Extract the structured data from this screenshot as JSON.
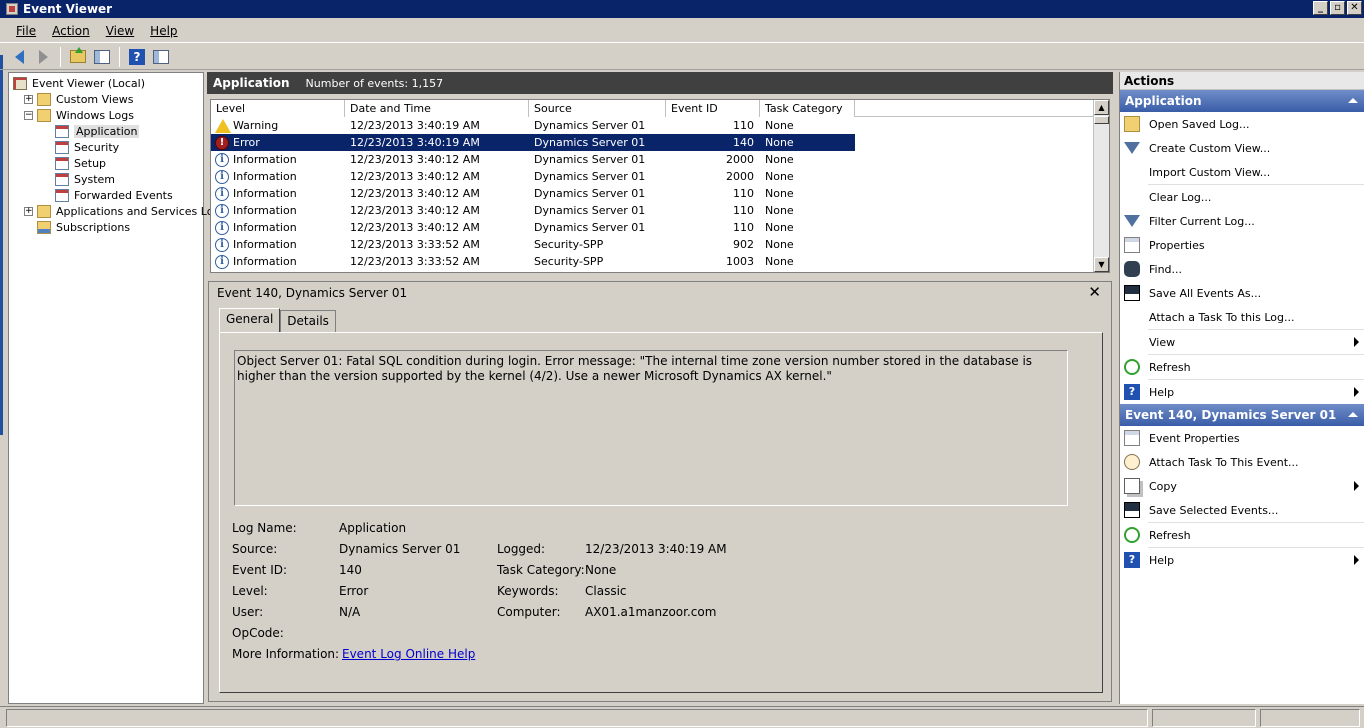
{
  "window": {
    "title": "Event Viewer"
  },
  "menu": [
    "File",
    "Action",
    "View",
    "Help"
  ],
  "tree": {
    "items": [
      {
        "label": "Event Viewer (Local)",
        "indent": 0
      },
      {
        "label": "Custom Views",
        "indent": 1,
        "expander": "+"
      },
      {
        "label": "Windows Logs",
        "indent": 1,
        "expander": "−"
      },
      {
        "label": "Application",
        "indent": 2,
        "selected": true
      },
      {
        "label": "Security",
        "indent": 2
      },
      {
        "label": "Setup",
        "indent": 2
      },
      {
        "label": "System",
        "indent": 2
      },
      {
        "label": "Forwarded Events",
        "indent": 2
      },
      {
        "label": "Applications and Services Logs",
        "indent": 1,
        "expander": "+"
      },
      {
        "label": "Subscriptions",
        "indent": 1
      }
    ]
  },
  "log": {
    "title": "Application",
    "count_text": "Number of events: 1,157",
    "columns": [
      "Level",
      "Date and Time",
      "Source",
      "Event ID",
      "Task Category"
    ],
    "rows": [
      {
        "level": "Warning",
        "icon": "warning-icon",
        "date": "12/23/2013 3:40:19 AM",
        "source": "Dynamics Server 01",
        "id": "110",
        "category": "None"
      },
      {
        "level": "Error",
        "icon": "error-icon",
        "date": "12/23/2013 3:40:19 AM",
        "source": "Dynamics Server 01",
        "id": "140",
        "category": "None",
        "selected": true
      },
      {
        "level": "Information",
        "icon": "info-icon",
        "date": "12/23/2013 3:40:12 AM",
        "source": "Dynamics Server 01",
        "id": "2000",
        "category": "None"
      },
      {
        "level": "Information",
        "icon": "info-icon",
        "date": "12/23/2013 3:40:12 AM",
        "source": "Dynamics Server 01",
        "id": "2000",
        "category": "None"
      },
      {
        "level": "Information",
        "icon": "info-icon",
        "date": "12/23/2013 3:40:12 AM",
        "source": "Dynamics Server 01",
        "id": "110",
        "category": "None"
      },
      {
        "level": "Information",
        "icon": "info-icon",
        "date": "12/23/2013 3:40:12 AM",
        "source": "Dynamics Server 01",
        "id": "110",
        "category": "None"
      },
      {
        "level": "Information",
        "icon": "info-icon",
        "date": "12/23/2013 3:40:12 AM",
        "source": "Dynamics Server 01",
        "id": "110",
        "category": "None"
      },
      {
        "level": "Information",
        "icon": "info-icon",
        "date": "12/23/2013 3:33:52 AM",
        "source": "Security-SPP",
        "id": "902",
        "category": "None"
      },
      {
        "level": "Information",
        "icon": "info-icon",
        "date": "12/23/2013 3:33:52 AM",
        "source": "Security-SPP",
        "id": "1003",
        "category": "None"
      }
    ]
  },
  "detail": {
    "title": "Event 140, Dynamics Server 01",
    "tabs": [
      "General",
      "Details"
    ],
    "message": "Object Server 01:  Fatal SQL condition during login. Error message: \"The internal time zone version number stored in the database is higher than the version supported by the kernel (4/2). Use a newer Microsoft Dynamics AX kernel.\"",
    "fields": {
      "log_name_label": "Log Name:",
      "log_name": "Application",
      "source_label": "Source:",
      "source": "Dynamics Server 01",
      "logged_label": "Logged:",
      "logged": "12/23/2013 3:40:19 AM",
      "event_id_label": "Event ID:",
      "event_id": "140",
      "task_category_label": "Task Category:",
      "task_category": "None",
      "level_label": "Level:",
      "level": "Error",
      "keywords_label": "Keywords:",
      "keywords": "Classic",
      "user_label": "User:",
      "user": "N/A",
      "computer_label": "Computer:",
      "computer": "AX01.a1manzoor.com",
      "opcode_label": "OpCode:",
      "more_info_label": "More Information:",
      "more_info_link": "Event Log Online Help"
    }
  },
  "actions": {
    "title": "Actions",
    "sections": [
      {
        "header": "Application",
        "items": [
          {
            "label": "Open Saved Log...",
            "icon": "open-log-icon"
          },
          {
            "label": "Create Custom View...",
            "icon": "filter-icon"
          },
          {
            "label": "Import Custom View...",
            "icon": ""
          },
          {
            "label": "Clear Log...",
            "icon": "",
            "sep_before": true
          },
          {
            "label": "Filter Current Log...",
            "icon": "filter-icon"
          },
          {
            "label": "Properties",
            "icon": "properties-icon"
          },
          {
            "label": "Find...",
            "icon": "find-icon"
          },
          {
            "label": "Save All Events As...",
            "icon": "save-icon"
          },
          {
            "label": "Attach a Task To this Log...",
            "icon": ""
          },
          {
            "label": "View",
            "icon": "",
            "submenu": true,
            "sep_before": true
          },
          {
            "label": "Refresh",
            "icon": "refresh-icon",
            "sep_before": true
          },
          {
            "label": "Help",
            "icon": "help-icon",
            "submenu": true,
            "sep_before": true
          }
        ]
      },
      {
        "header": "Event 140, Dynamics Server 01",
        "items": [
          {
            "label": "Event Properties",
            "icon": "properties-icon"
          },
          {
            "label": "Attach Task To This Event...",
            "icon": "task-icon"
          },
          {
            "label": "Copy",
            "icon": "copy-icon",
            "submenu": true
          },
          {
            "label": "Save Selected Events...",
            "icon": "save-icon"
          },
          {
            "label": "Refresh",
            "icon": "refresh-icon",
            "sep_before": true
          },
          {
            "label": "Help",
            "icon": "help-icon",
            "submenu": true,
            "sep_before": true
          }
        ]
      }
    ]
  },
  "colors": {
    "title_bar": "#0a246a",
    "selection": "#0a246a",
    "action_header": "#3a5da8",
    "chrome": "#d4d0c8"
  }
}
